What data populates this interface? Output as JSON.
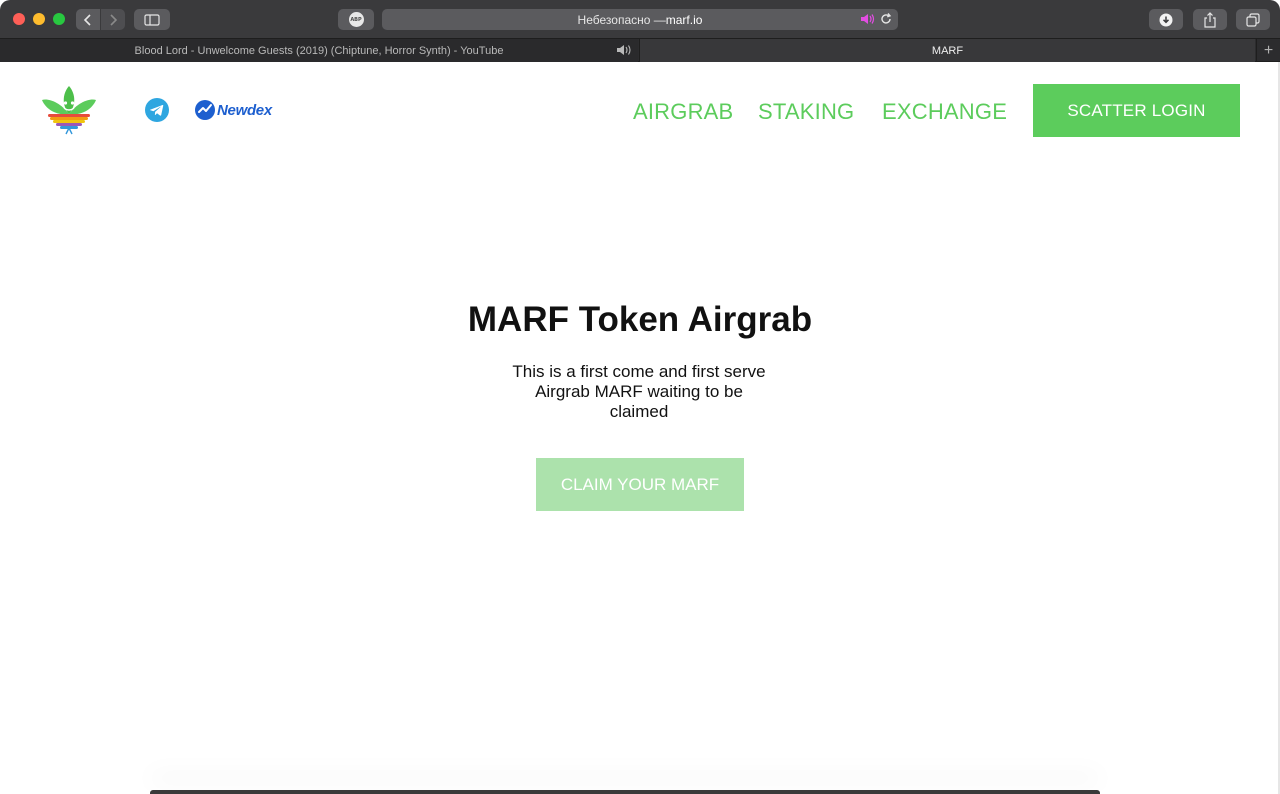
{
  "browser": {
    "address_prefix": "Небезопасно — ",
    "address_host": "marf.io",
    "abp_label": "ABP",
    "tabs": [
      {
        "label": "Blood Lord - Unwelcome Guests (2019) (Chiptune, Horror Synth) - YouTube"
      },
      {
        "label": "MARF"
      }
    ],
    "new_tab": "+"
  },
  "header": {
    "newdex_label": "Newdex",
    "nav": [
      {
        "label": "AIRGRAB"
      },
      {
        "label": "STAKING"
      },
      {
        "label": "EXCHANGE"
      }
    ],
    "scatter_login": "SCATTER LOGIN"
  },
  "hero": {
    "title": "MARF Token Airgrab",
    "subtitle": "This is a first come and first serve Airgrab MARF waiting to be claimed",
    "claim_button": "CLAIM YOUR MARF"
  },
  "colors": {
    "accent_green": "#5ccc5c",
    "disabled_green": "#ace2ac",
    "newdex_blue": "#1d5fcf",
    "telegram_blue": "#2ea6e0"
  },
  "icons": {
    "back": "chevron-left-icon",
    "forward": "chevron-right-icon",
    "sidebar": "sidebar-icon",
    "reload": "reload-icon",
    "speaker": "speaker-icon",
    "download": "download-icon",
    "share": "share-icon",
    "tabs": "tabs-overview-icon",
    "telegram": "telegram-icon",
    "newdex": "newdex-logo-icon",
    "logo": "marf-leaf-logo-icon"
  }
}
